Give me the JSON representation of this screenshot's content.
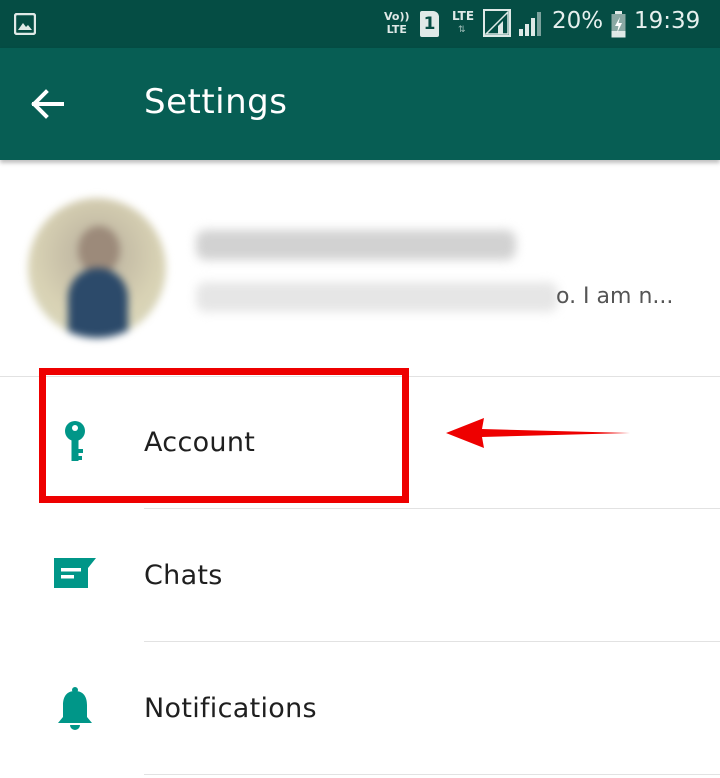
{
  "status_bar": {
    "volte_top": "Vo))",
    "volte_bottom": "LTE",
    "sim_slot": "1",
    "network": "LTE",
    "battery_percent": "20%",
    "time": "19:39"
  },
  "app_bar": {
    "title": "Settings"
  },
  "profile": {
    "status_visible_tail": "o. I am n..."
  },
  "settings": {
    "items": [
      {
        "label": "Account",
        "icon": "key-icon"
      },
      {
        "label": "Chats",
        "icon": "chat-icon"
      },
      {
        "label": "Notifications",
        "icon": "bell-icon"
      }
    ]
  },
  "colors": {
    "status_bar": "#054d44",
    "app_bar": "#075e54",
    "icon_accent": "#009688",
    "annotation_red": "#ee0000"
  }
}
